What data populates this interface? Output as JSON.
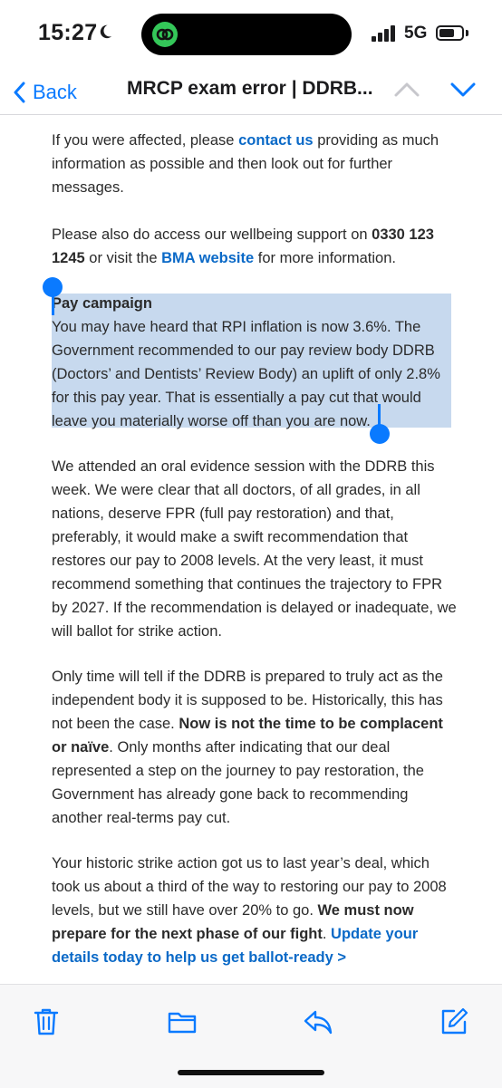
{
  "status_bar": {
    "time": "15:27",
    "network": "5G"
  },
  "nav": {
    "back_label": "Back",
    "title": "MRCP exam error | DDRB..."
  },
  "email": {
    "p1": {
      "before": "If you were affected, please ",
      "link": "contact us",
      "after": " providing as much information as possible and then look out for further messages."
    },
    "p2": {
      "before": "Please also do access our wellbeing support on ",
      "phone": "0330 123 1245",
      "middle": " or visit the ",
      "link": "BMA website",
      "after": " for more information."
    },
    "pay": {
      "title": "Pay campaign",
      "text": "You may have heard that RPI inflation is now 3.6%. The Government recommended to our pay review body DDRB (Doctors’ and Dentists’ Review Body) an uplift of only 2.8% for this pay year. That is essentially a pay cut that would leave you materially worse off than you are now."
    },
    "p4": "We attended an oral evidence session with the DDRB this week. We were clear that all doctors, of all grades, in all nations, deserve FPR (full pay restoration) and that, preferably, it would make a swift recommendation that restores our pay to 2008 levels. At the very least, it must recommend something that continues the trajectory to FPR by 2027. If the recommendation is delayed or inadequate, we will ballot for strike action.",
    "p5": {
      "before": "Only time will tell if the DDRB is prepared to truly act as the independent body it is supposed to be. Historically, this has not been the case. ",
      "bold": "Now is not the time to be complacent or naïve",
      "after": ". Only months after indicating that our deal represented a step on the journey to pay restoration, the Government has already gone back to recommending another real-terms pay cut."
    },
    "p6": {
      "before": "Your historic strike action got us to last year’s deal, which took us about a third of the way to restoring our pay to 2008 levels, but we still have over 20% to go. ",
      "bold": "We must now prepare for the next phase of our fight",
      "middle": ". ",
      "link": "Update your details today to help us get ballot-ready >"
    }
  },
  "toolbar": {
    "icons": [
      "trash-icon",
      "folder-icon",
      "reply-icon",
      "compose-icon"
    ]
  },
  "colors": {
    "accent": "#0a7aff",
    "link": "#0a69c7",
    "selection": "#c7d9ee",
    "dynamic_island_app": "#34c759"
  }
}
